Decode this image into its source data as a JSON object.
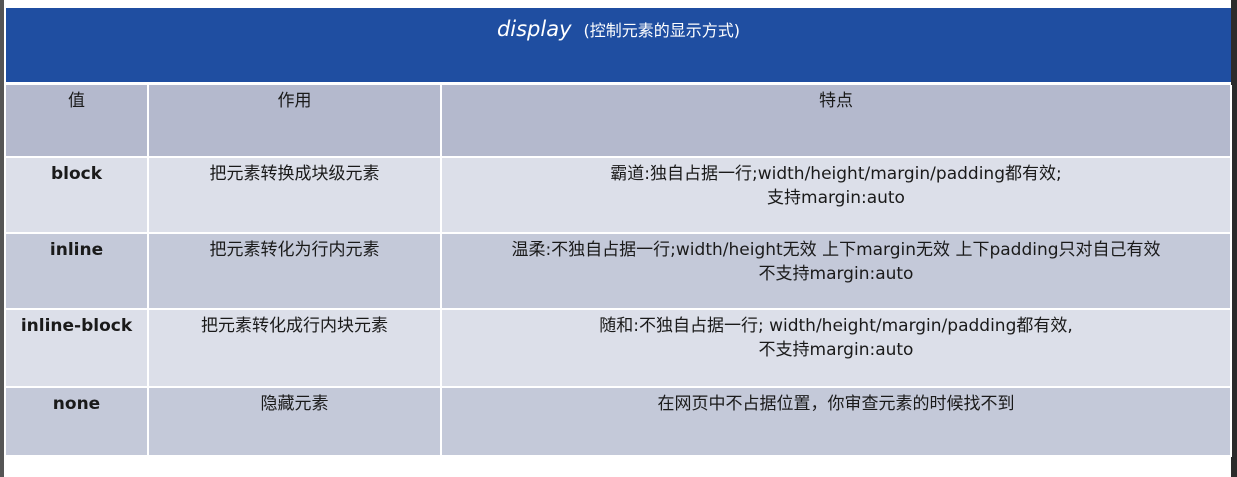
{
  "title": {
    "code": "display",
    "desc": "(控制元素的显示方式)"
  },
  "table": {
    "headers": [
      "值",
      "作用",
      "特点"
    ],
    "rows": [
      {
        "value": "block",
        "effect": "把元素转换成块级元素",
        "feature_line1": "霸道:独自占据一行;width/height/margin/padding都有效;",
        "feature_line2": "支持margin:auto"
      },
      {
        "value": "inline",
        "effect": "把元素转化为行内元素",
        "feature_line1": "温柔:不独自占据一行;width/height无效 上下margin无效 上下padding只对自己有效",
        "feature_line2": "不支持margin:auto"
      },
      {
        "value": "inline-block",
        "effect": "把元素转化成行内块元素",
        "feature_line1": "随和:不独自占据一行; width/height/margin/padding都有效,",
        "feature_line2": "不支持margin:auto"
      },
      {
        "value": "none",
        "effect": "隐藏元素",
        "feature_line1": "在网页中不占据位置，你审查元素的时候找不到",
        "feature_line2": ""
      }
    ]
  },
  "colors": {
    "title_bar": "#1f4ea1",
    "header_row": "#b4b9cd",
    "row_light": "#dcdfe9",
    "row_dark": "#c4c9d9"
  }
}
